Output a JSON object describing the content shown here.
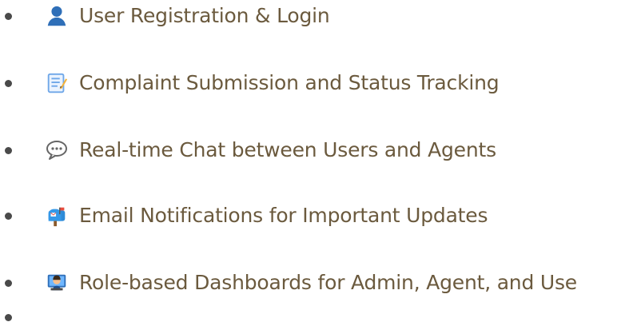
{
  "colors": {
    "text": "#6b5a3e",
    "bullet": "#4a4a4a",
    "user_icon": "#2f6fb8",
    "memo_icon": "#6fa7e8",
    "chat_icon": "#666666",
    "mailbox_icon": "#2e8bd8",
    "technologist_icon": "#2f6fb8"
  },
  "features": [
    {
      "icon": "user-icon",
      "label": "User Registration & Login"
    },
    {
      "icon": "memo-icon",
      "label": "Complaint Submission and Status Tracking"
    },
    {
      "icon": "speech-balloon-icon",
      "label": "Real-time Chat between Users and Agents"
    },
    {
      "icon": "mailbox-icon",
      "label": "Email Notifications for Important Updates"
    },
    {
      "icon": "technologist-icon",
      "label": "Role-based Dashboards for Admin, Agent, and Use"
    },
    {
      "icon": "",
      "label": ""
    }
  ]
}
